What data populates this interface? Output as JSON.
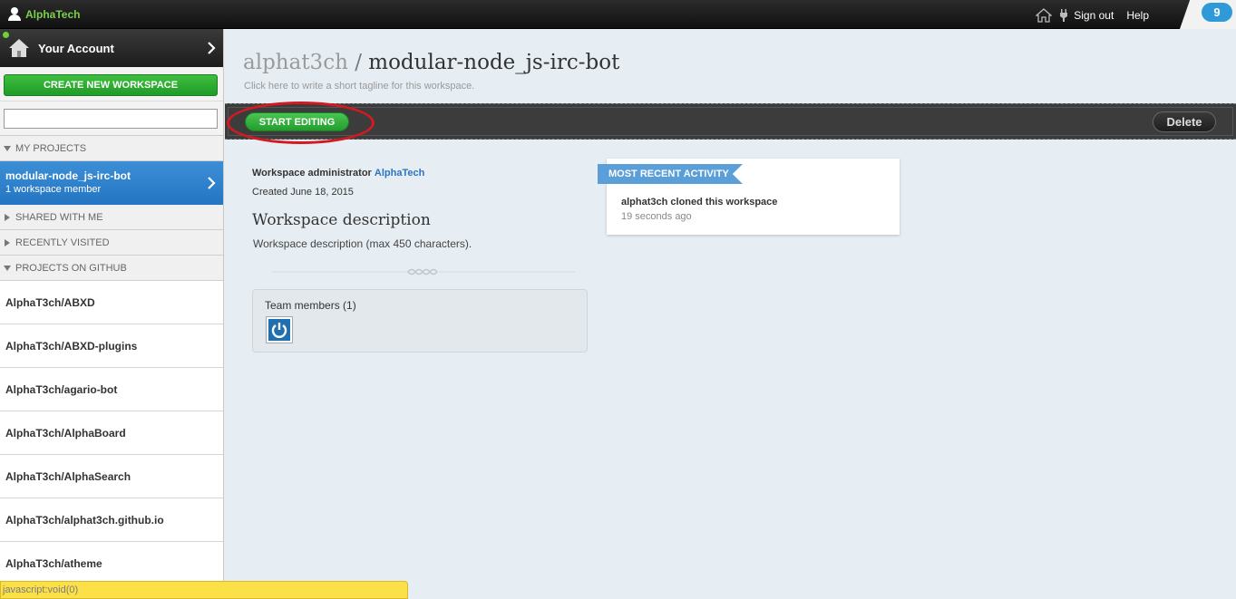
{
  "topbar": {
    "brand": "AlphaTech",
    "sign_out": "Sign out",
    "help": "Help",
    "notifications": "9"
  },
  "sidebar": {
    "account_label": "Your Account",
    "create_button": "CREATE NEW WORKSPACE",
    "search_value": "",
    "sections": {
      "my_projects": "MY PROJECTS",
      "shared": "SHARED WITH ME",
      "recent": "RECENTLY VISITED",
      "github": "PROJECTS ON GITHUB"
    },
    "active_project": {
      "name": "modular-node_js-irc-bot",
      "meta": "1 workspace member"
    },
    "github_projects": [
      "AlphaT3ch/ABXD",
      "AlphaT3ch/ABXD-plugins",
      "AlphaT3ch/agario-bot",
      "AlphaT3ch/AlphaBoard",
      "AlphaT3ch/AlphaSearch",
      "AlphaT3ch/alphat3ch.github.io",
      "AlphaT3ch/atheme"
    ]
  },
  "status_bar": "javascript:void(0)",
  "workspace": {
    "owner": "alphat3ch",
    "separator": "/",
    "name": "modular-node_js-irc-bot",
    "tagline": "Click here to write a short tagline for this workspace.",
    "start_editing": "START EDITING",
    "delete": "Delete",
    "admin_label": "Workspace administrator",
    "admin_name": "AlphaTech",
    "created": "Created June 18, 2015",
    "description_heading": "Workspace description",
    "description_text": "Workspace description (max 450 characters).",
    "team_label": "Team members (1)"
  },
  "activity": {
    "heading": "MOST RECENT ACTIVITY",
    "text": "alphat3ch cloned this workspace",
    "time": "19 seconds ago"
  },
  "colors": {
    "brand_green": "#7dd04a",
    "create_green": "#1f9b27",
    "active_blue": "#2475c2",
    "ribbon_blue": "#5a9fd8",
    "highlight_red": "#d21a22"
  }
}
